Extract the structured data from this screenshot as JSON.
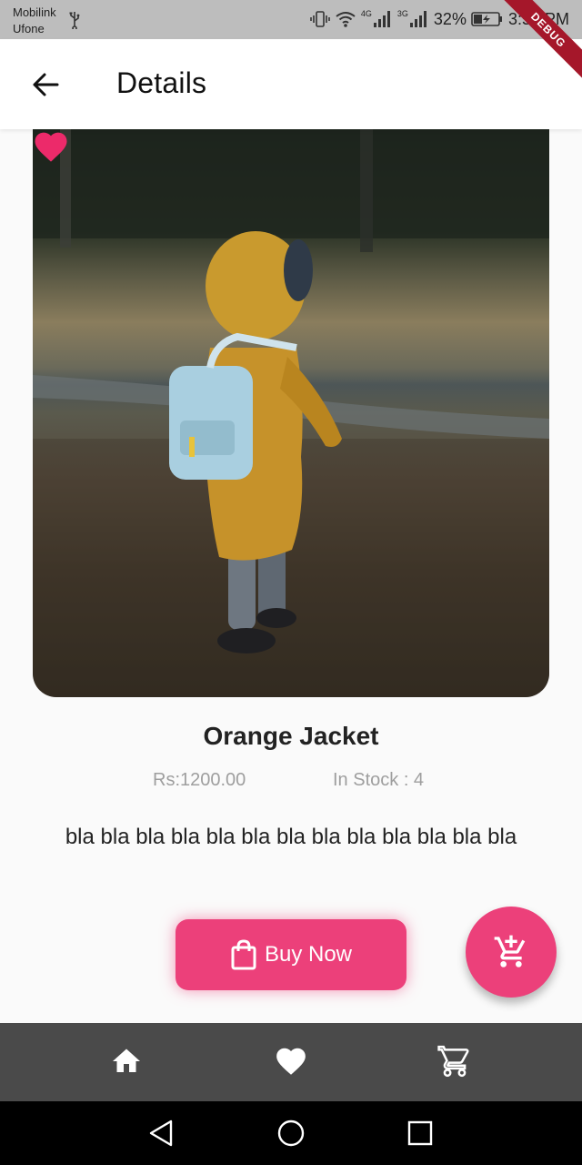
{
  "status_bar": {
    "carrier_line1": "Mobilink",
    "carrier_line2": "Ufone",
    "sim1_network": "4G",
    "sim2_network": "3G",
    "battery": "32%",
    "time": "3:57 PM"
  },
  "debug_banner": "DEBUG",
  "app_bar": {
    "title": "Details"
  },
  "product": {
    "name": "Orange Jacket",
    "price": "Rs:1200.00",
    "stock": "In Stock : 4",
    "description": "bla bla bla bla bla bla bla bla bla bla bla bla bla",
    "favorited": true
  },
  "actions": {
    "buy_label": "Buy Now"
  },
  "colors": {
    "accent": "#ec407a",
    "bottom_nav": "#4a4a4a",
    "status_bar": "#bdbdbd",
    "debug_ribbon": "#a5172a"
  },
  "bottom_nav": {
    "items": [
      {
        "icon": "home-icon"
      },
      {
        "icon": "heart-icon"
      },
      {
        "icon": "cart-icon"
      }
    ]
  },
  "system_nav": {
    "items": [
      "back",
      "home",
      "recents"
    ]
  }
}
